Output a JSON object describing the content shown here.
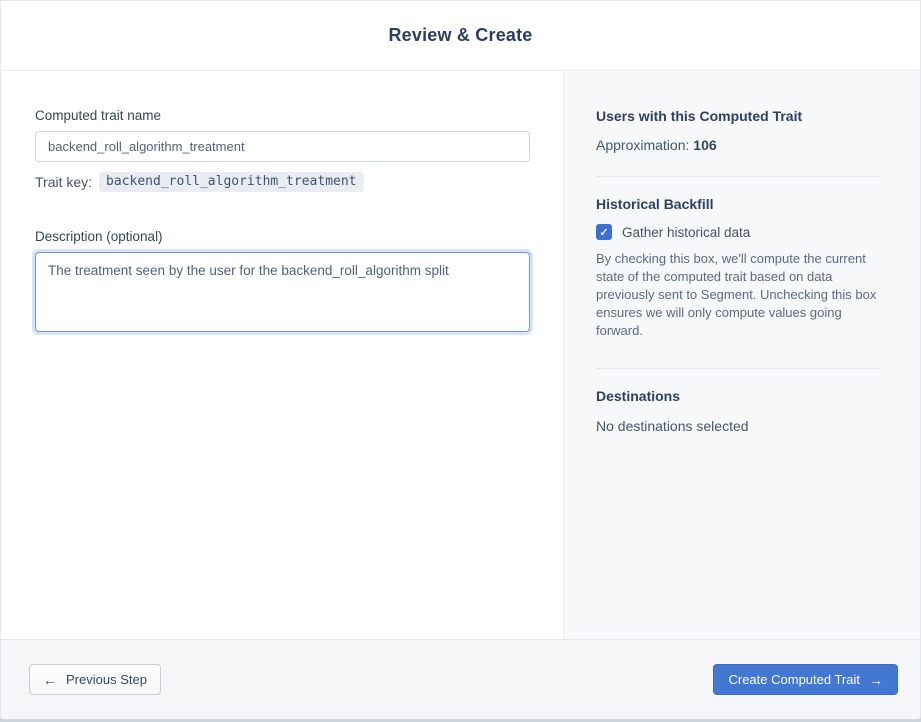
{
  "header": {
    "title": "Review & Create"
  },
  "form": {
    "name_label": "Computed trait name",
    "name_value": "backend_roll_algorithm_treatment",
    "trait_key_label": "Trait key:",
    "trait_key_value": "backend_roll_algorithm_treatment",
    "description_label": "Description (optional)",
    "description_value": "The treatment seen by the user for the backend_roll_algorithm split"
  },
  "sidebar": {
    "users_heading": "Users with this Computed Trait",
    "approximation_label": "Approximation: ",
    "approximation_value": "106",
    "backfill_heading": "Historical Backfill",
    "backfill_checkbox_label": "Gather historical data",
    "backfill_checkbox_checked": true,
    "backfill_description": "By checking this box, we'll compute the current state of the computed trait based on data previously sent to Segment. Unchecking this box ensures we will only compute values going forward.",
    "destinations_heading": "Destinations",
    "destinations_empty": "No destinations selected"
  },
  "footer": {
    "previous_label": "Previous Step",
    "create_label": "Create Computed Trait"
  },
  "icons": {
    "back_arrow": "←",
    "forward_arrow": "→",
    "check": "✓"
  },
  "colors": {
    "primary_blue": "#4277d2",
    "checkbox_blue": "#3a70d2",
    "heading_navy": "#2e4164",
    "sidebar_bg": "#f7f8fa",
    "footer_bg": "#f5f6f8"
  }
}
